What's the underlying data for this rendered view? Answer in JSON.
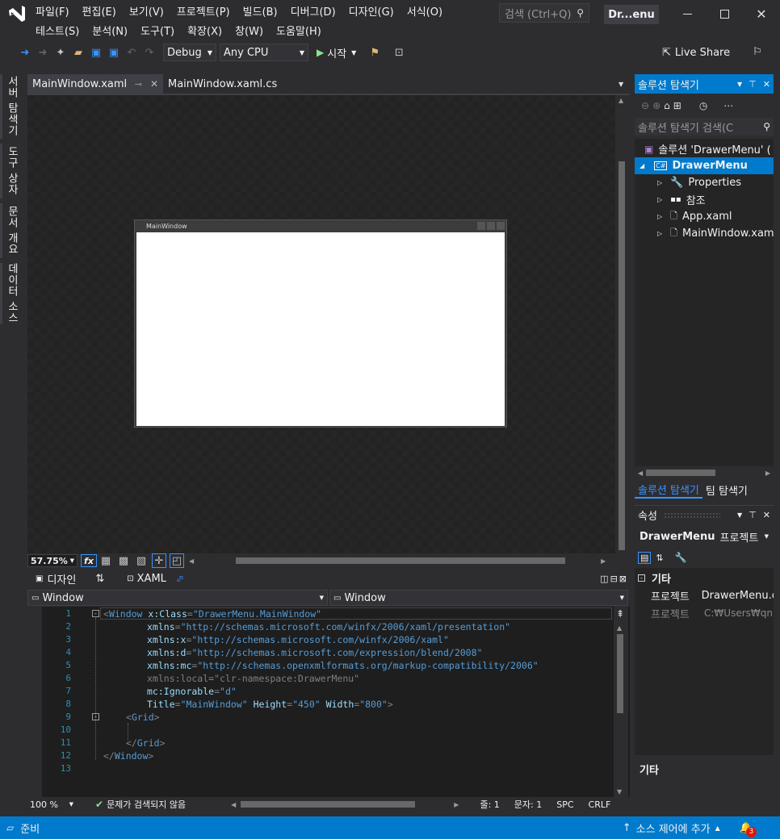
{
  "title": "Dr...enu",
  "menu_row1": [
    "파일(F)",
    "편집(E)",
    "보기(V)",
    "프로젝트(P)",
    "빌드(B)",
    "디버그(D)",
    "디자인(G)",
    "서식(O)"
  ],
  "menu_row2": [
    "테스트(S)",
    "분석(N)",
    "도구(T)",
    "확장(X)",
    "창(W)",
    "도움말(H)"
  ],
  "search_placeholder": "검색 (Ctrl+Q)",
  "toolbar": {
    "config": "Debug",
    "platform": "Any CPU",
    "start": "시작",
    "live_share": "Live Share"
  },
  "left_tabs": [
    "서버 탐색기",
    "도구 상자",
    "문서 개요",
    "데이터 소스"
  ],
  "doc_tabs": [
    {
      "label": "MainWindow.xaml",
      "active": true
    },
    {
      "label": "MainWindow.xaml.cs",
      "active": false
    }
  ],
  "designer": {
    "window_title": "MainWindow",
    "zoom": "57.75%",
    "fx": "fx"
  },
  "split_tabs": {
    "design": "디자인",
    "swap": "⇅",
    "xaml": "XAML"
  },
  "nav": {
    "left": "Window",
    "right": "Window"
  },
  "code_lines": [
    "1",
    "2",
    "3",
    "4",
    "5",
    "6",
    "7",
    "8",
    "9",
    "10",
    "11",
    "12",
    "13"
  ],
  "code": {
    "l1_tag": "Window",
    "l1_attr": "x:Class",
    "l1_val": "\"DrawerMenu.MainWindow\"",
    "l2_attr": "xmlns",
    "l2_val": "\"http://schemas.microsoft.com/winfx/2006/xaml/presentation\"",
    "l3_attr": "xmlns:x",
    "l3_val": "\"http://schemas.microsoft.com/winfx/2006/xaml\"",
    "l4_attr": "xmlns:d",
    "l4_val": "\"http://schemas.microsoft.com/expression/blend/2008\"",
    "l5_attr": "xmlns:mc",
    "l5_val": "\"http://schemas.openxmlformats.org/markup-compatibility/2006\"",
    "l6": "xmlns:local=\"clr-namespace:DrawerMenu\"",
    "l7_attr": "mc:Ignorable",
    "l7_val": "\"d\"",
    "l8_a1": "Title",
    "l8_v1": "\"MainWindow\"",
    "l8_a2": "Height",
    "l8_v2": "\"450\"",
    "l8_a3": "Width",
    "l8_v3": "\"800\"",
    "l9": "Grid",
    "l11": "Grid",
    "l12": "Window"
  },
  "editor_status": {
    "zoom": "100 %",
    "issues": "문제가 검색되지 않음",
    "line": "줄: 1",
    "col": "문자: 1",
    "spc": "SPC",
    "crlf": "CRLF"
  },
  "solution_explorer": {
    "title": "솔루션 탐색기",
    "search_placeholder": "솔루션 탐색기 검색(C",
    "solution": "솔루션 'DrawerMenu' (",
    "project": "DrawerMenu",
    "items": [
      "Properties",
      "참조",
      "App.xaml",
      "MainWindow.xaml"
    ],
    "bottom_tabs": [
      "솔루션 탐색기",
      "팀 탐색기"
    ]
  },
  "properties": {
    "title": "속성",
    "object": "DrawerMenu",
    "object_type": "프로젝트",
    "category": "기타",
    "rows": [
      {
        "name": "프로젝트",
        "value": "DrawerMenu.c"
      },
      {
        "name": "프로젝트",
        "value": "C:₩Users₩qn"
      }
    ],
    "desc_title": "기타"
  },
  "status_bar": {
    "ready": "준비",
    "source_control": "소스 제어에 추가",
    "notifications": "3"
  },
  "colors": {
    "accent": "#007acc",
    "editor_bg": "#1e1e1e",
    "chrome": "#2d2d30",
    "designer_bg": "#232323"
  }
}
